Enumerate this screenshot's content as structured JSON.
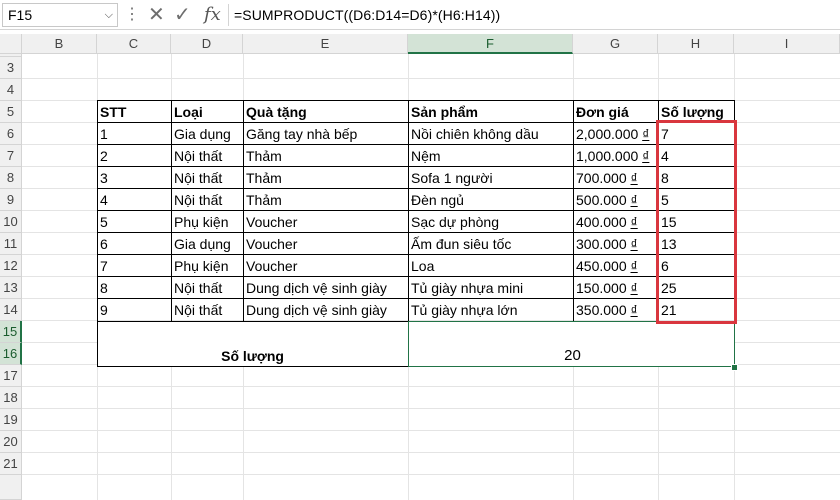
{
  "formula_bar": {
    "name_box": "F15",
    "formula": "=SUMPRODUCT((D6:D14=D6)*(H6:H14))"
  },
  "columns": [
    "B",
    "C",
    "D",
    "E",
    "F",
    "G",
    "H",
    "I"
  ],
  "rows": [
    "3",
    "4",
    "5",
    "6",
    "7",
    "8",
    "9",
    "10",
    "11",
    "12",
    "13",
    "14",
    "15",
    "16",
    "17",
    "18",
    "19",
    "20",
    "21"
  ],
  "table": {
    "headers": [
      "STT",
      "Loại",
      "Quà tặng",
      "Sản phẩm",
      "Đơn giá",
      "Số lượng"
    ],
    "rows": [
      {
        "stt": "1",
        "loai": "Gia dụng",
        "qua": "Găng tay nhà bếp",
        "sp": "Nồi chiên không dầu",
        "price": "2,000.000",
        "unit": "₫",
        "qty": "7"
      },
      {
        "stt": "2",
        "loai": "Nội thất",
        "qua": "Thảm",
        "sp": "Nệm",
        "price": "1,000.000",
        "unit": "₫",
        "qty": "4"
      },
      {
        "stt": "3",
        "loai": "Nội thất",
        "qua": "Thảm",
        "sp": "Sofa 1 người",
        "price": "700.000",
        "unit": "₫",
        "qty": "8"
      },
      {
        "stt": "4",
        "loai": "Nội thất",
        "qua": "Thảm",
        "sp": "Đèn ngủ",
        "price": "500.000",
        "unit": "₫",
        "qty": "5"
      },
      {
        "stt": "5",
        "loai": "Phụ kiện",
        "qua": "Voucher",
        "sp": "Sạc dự phòng",
        "price": "400.000",
        "unit": "₫",
        "qty": "15"
      },
      {
        "stt": "6",
        "loai": "Gia dụng",
        "qua": "Voucher",
        "sp": "Ấm đun siêu tốc",
        "price": "300.000",
        "unit": "₫",
        "qty": "13"
      },
      {
        "stt": "7",
        "loai": "Phụ kiện",
        "qua": "Voucher",
        "sp": "Loa",
        "price": "450.000",
        "unit": "₫",
        "qty": "6"
      },
      {
        "stt": "8",
        "loai": "Nội thất",
        "qua": "Dung dịch vệ sinh giày",
        "sp": "Tủ giày nhựa mini",
        "price": "150.000",
        "unit": "₫",
        "qty": "25"
      },
      {
        "stt": "9",
        "loai": "Nội thất",
        "qua": "Dung dịch vệ sinh giày",
        "sp": "Tủ giày nhựa lớn",
        "price": "350.000",
        "unit": "₫",
        "qty": "21"
      }
    ],
    "summary_label": "Số lượng",
    "summary_value": "20"
  },
  "colors": {
    "selection": "#217346",
    "highlight": "#d9363e"
  },
  "icons": [
    "chevron-down-icon",
    "more-options-icon",
    "cancel-icon",
    "enter-icon",
    "function-icon"
  ]
}
